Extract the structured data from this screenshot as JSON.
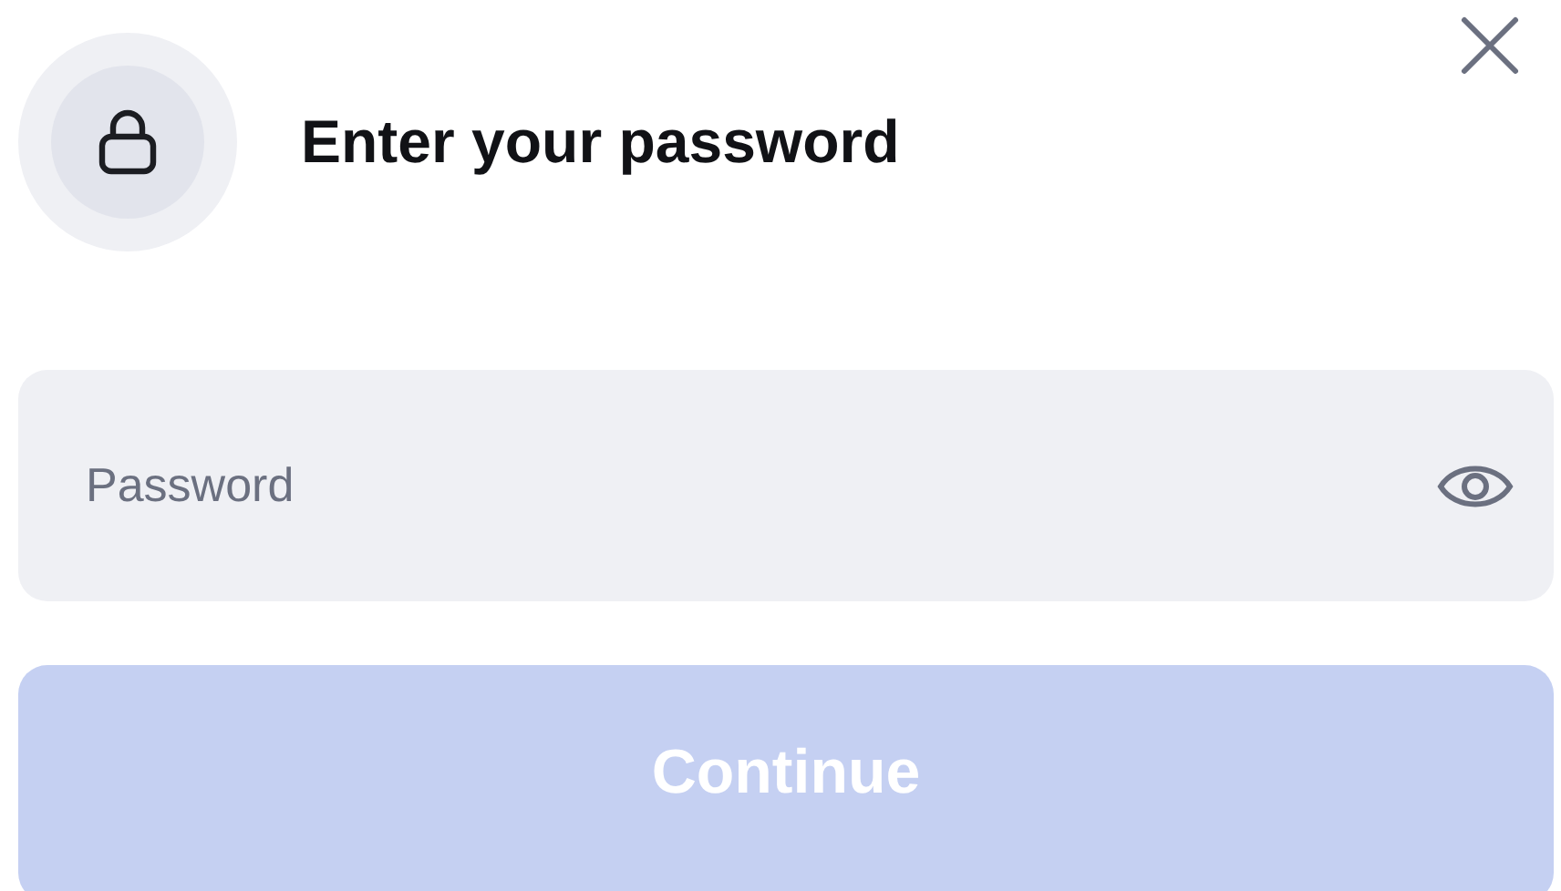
{
  "dialog": {
    "title": "Enter your password"
  },
  "password_field": {
    "placeholder": "Password"
  },
  "continue_button": {
    "label": "Continue",
    "disabled": true
  }
}
